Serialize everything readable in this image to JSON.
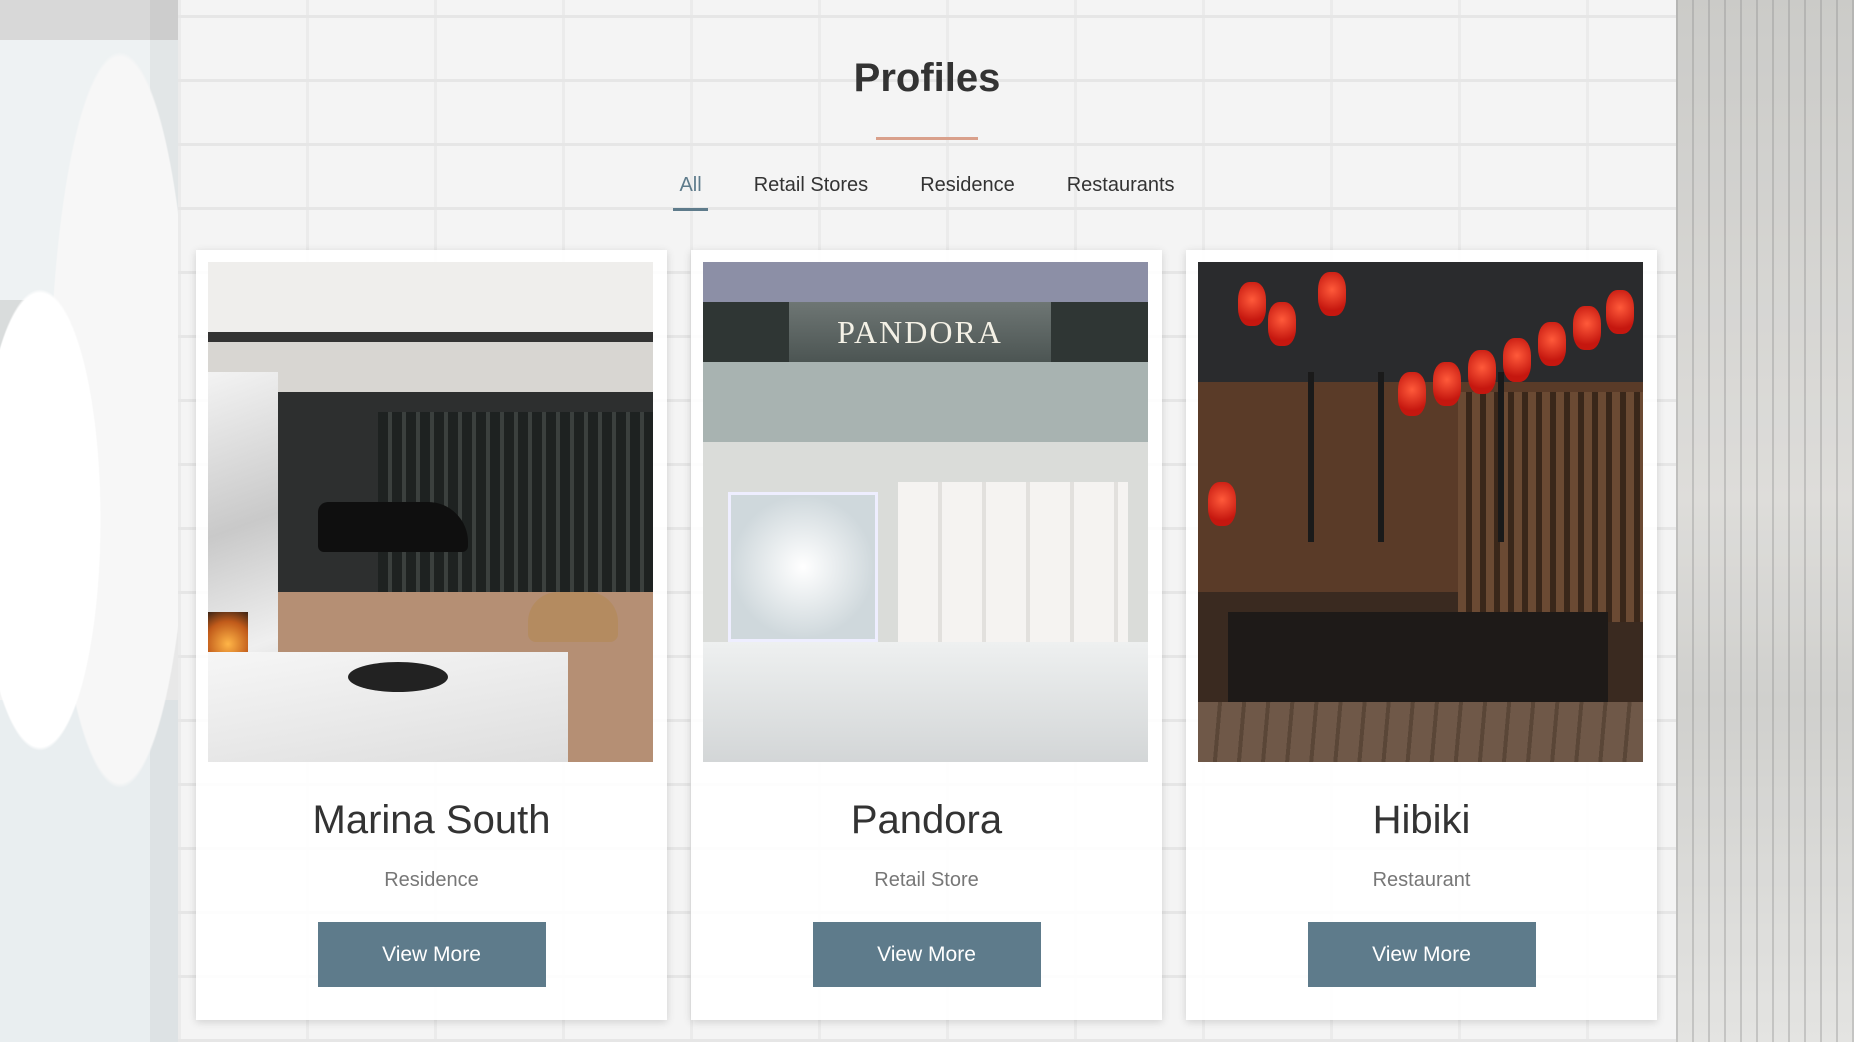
{
  "page": {
    "title": "Profiles",
    "accent_color": "#d9a08b",
    "button_color": "#5e7b8b"
  },
  "filters": {
    "tabs": [
      {
        "label": "All",
        "active": true
      },
      {
        "label": "Retail Stores",
        "active": false
      },
      {
        "label": "Residence",
        "active": false
      },
      {
        "label": "Restaurants",
        "active": false
      }
    ]
  },
  "profiles": [
    {
      "name": "Marina South",
      "type": "Residence",
      "button_label": "View More",
      "image_desc": "living-room-photo"
    },
    {
      "name": "Pandora",
      "type": "Retail Store",
      "button_label": "View More",
      "image_desc": "jewelry-store-photo",
      "sign_text": "PANDORA"
    },
    {
      "name": "Hibiki",
      "type": "Restaurant",
      "button_label": "View More",
      "image_desc": "restaurant-photo"
    }
  ]
}
